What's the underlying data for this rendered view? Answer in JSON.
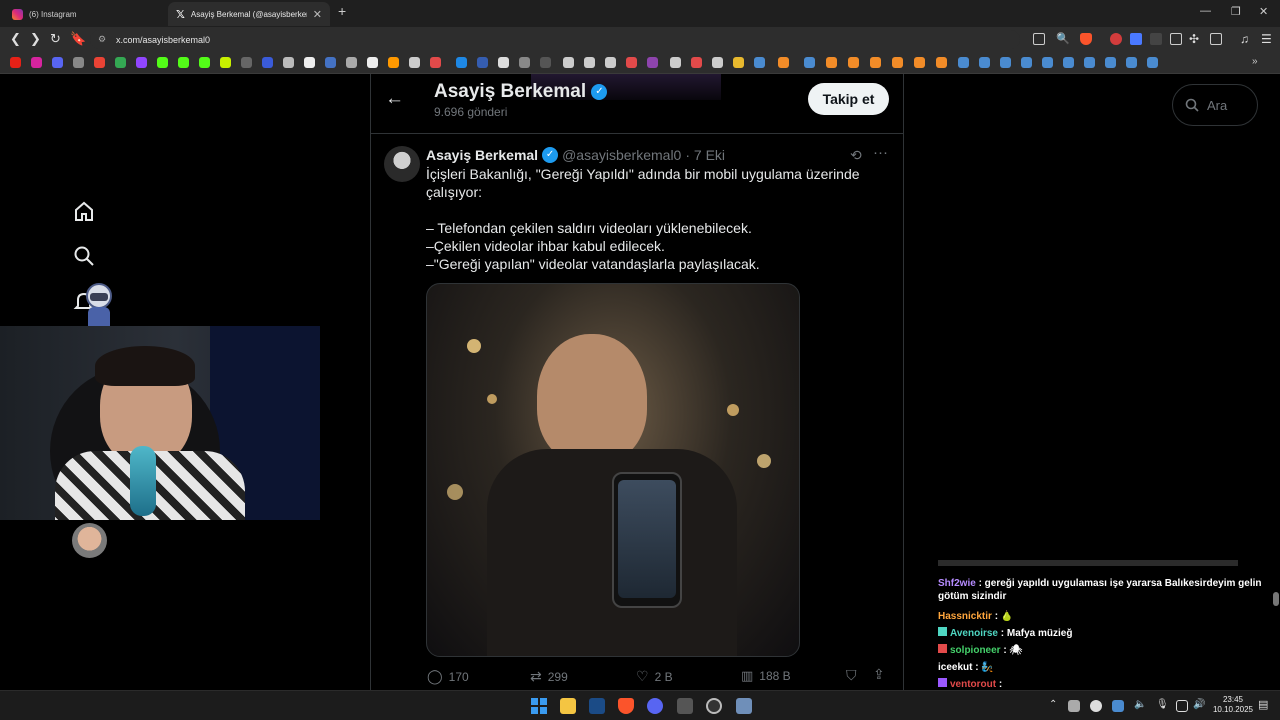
{
  "tabs": [
    {
      "label": "(6) Instagram"
    },
    {
      "label": "Asayiş Berkemal (@asayisberken"
    }
  ],
  "address": {
    "url": "x.com/asayisberkemal0"
  },
  "profile": {
    "name": "Asayiş Berkemal",
    "post_count": "9.696 gönderi",
    "follow_label": "Takip et"
  },
  "search": {
    "placeholder": "Ara"
  },
  "tweet": {
    "author": "Asayiş Berkemal",
    "handle": "@asayisberkemal0",
    "date": "· 7 Eki",
    "text": "İçişleri Bakanlığı, \"Gereği Yapıldı\" adında bir mobil uygulama üzerinde çalışıyor:\n\n– Telefondan çekilen saldırı videoları yüklenebilecek.\n–Çekilen videolar ihbar kabul edilecek.\n–\"Gereği yapılan\" videolar vatandaşlarla paylaşılacak.",
    "stats": {
      "replies": "170",
      "reposts": "299",
      "likes": "2 B",
      "views": "188 B"
    }
  },
  "chat": [
    {
      "user": "Shf2wie",
      "color": "#b68cff",
      "text": " : gereği yapıldı uygulaması işe yararsa Balıkesirdeyim gelin götüm sizindir"
    },
    {
      "user": "Hassnicktir",
      "color": "#ffa63d",
      "text": " : 🍐"
    },
    {
      "user": "Avenoirse",
      "color": "#4fd6c2",
      "text": " : Mafya müzieğ"
    },
    {
      "user": "solpioneer",
      "color": "#44d06a",
      "text": " : 🕷"
    },
    {
      "user": "iceekut",
      "color": "#ffffff",
      "text": " : 🧞"
    },
    {
      "user": "ventorout",
      "color": "#e24a4a",
      "text": " : "
    }
  ],
  "clock": {
    "time": "23:45",
    "date": "10.10.2025"
  },
  "colors": {
    "accent": "#1d9bf0",
    "bg": "#000000"
  }
}
